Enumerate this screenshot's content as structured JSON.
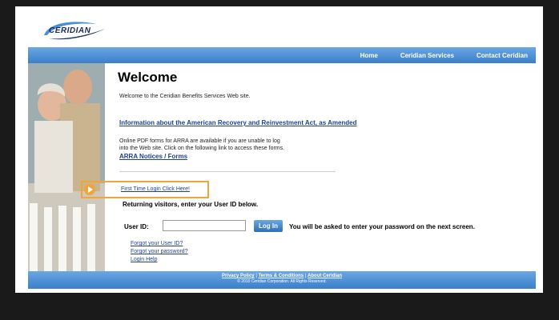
{
  "brand": {
    "name": "CERIDIAN"
  },
  "nav": {
    "home": "Home",
    "services": "Ceridian Services",
    "contact": "Contact Ceridian"
  },
  "main": {
    "title": "Welcome",
    "intro": "Welcome to the Ceridian Benefits Services Web site.",
    "arra_link": "Information about the American Recovery and Reinvestment Act, as Amended",
    "pdf_line1": "Online PDF forms for ARRA are available if you are unable to log",
    "pdf_line2": "into the Web site. Click on the following link to access these forms.",
    "notices_link": "ARRA Notices / Forms",
    "first_time": "First Time Login Click Here!",
    "returning": "Returning visitors, enter your User ID below.",
    "userid_label": "User ID:",
    "login_button": "Log In",
    "password_note": "You will be asked to enter your password on the next screen.",
    "forgot_id": "Forgot your User ID?",
    "forgot_pw": "Forgot your password?",
    "login_help": "Login Help"
  },
  "footer": {
    "privacy": "Privacy Policy",
    "terms": "Terms & Conditions",
    "about": "About Ceridian",
    "copyright": "© 2010 Ceridian Corporation. All Rights Reserved."
  },
  "colors": {
    "nav_blue": "#4a8fd6",
    "link_blue": "#1f3f93",
    "highlight": "#f0a53a"
  }
}
